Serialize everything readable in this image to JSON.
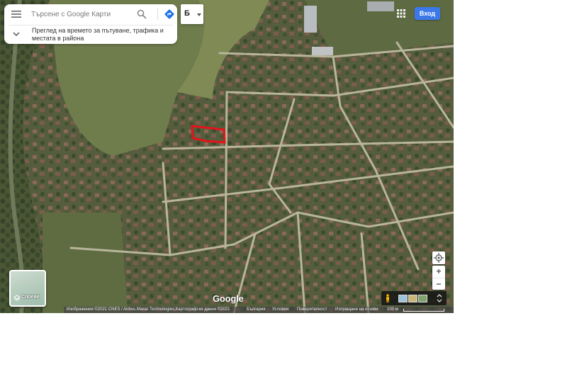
{
  "search": {
    "placeholder": "Търсене с Google Карти",
    "subtitle": "Преглед на времето за пътуване, трафика и местата в района"
  },
  "icons": {
    "menu": "menu-icon",
    "search": "search-icon",
    "directions": "directions-icon",
    "chevron": "chevron-down-icon",
    "apps": "apps-grid-icon",
    "layers": "layers-icon",
    "location": "my-location-icon",
    "pegman": "street-view-pegman-icon"
  },
  "translit": {
    "glyph": "Б"
  },
  "header": {
    "signin_label": "Вход"
  },
  "layers": {
    "label": "Слоеве"
  },
  "zoom": {
    "in": "+",
    "out": "−"
  },
  "logo": "Google",
  "footer": {
    "imagery": "Изображения ©2021 CNES / Airbus,Maxar Technologies,Картографски данни ©2021",
    "country": "България",
    "terms": "Условия",
    "privacy": "Поверителност",
    "feedback": "Изпращане на отзиви",
    "scale": "100 м"
  },
  "colors": {
    "accent": "#3b79ea",
    "directions": "#1a73e8",
    "highlight": "#e3141a"
  }
}
